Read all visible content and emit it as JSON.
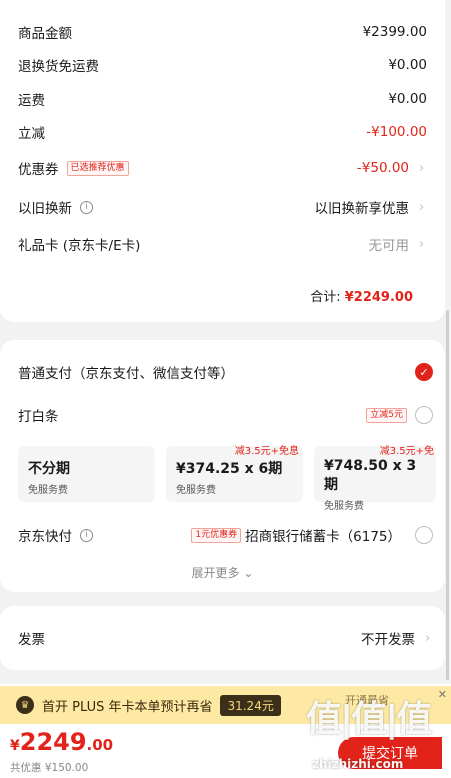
{
  "summary": {
    "goods_amount": {
      "label": "商品金额",
      "value": "¥2399.00"
    },
    "return_shipping": {
      "label": "退换货免运费",
      "value": "¥0.00"
    },
    "shipping": {
      "label": "运费",
      "value": "¥0.00"
    },
    "instant_discount": {
      "label": "立减",
      "value": "-¥100.00"
    },
    "coupon": {
      "label": "优惠券",
      "tag": "已选推荐优惠",
      "value": "-¥50.00"
    },
    "trade_in": {
      "label": "以旧换新",
      "value": "以旧换新享优惠"
    },
    "gift_card": {
      "label": "礼品卡 (京东卡/E卡)",
      "value": "无可用"
    },
    "total_label": "合计:",
    "total_value": "¥2249.00"
  },
  "payment": {
    "normal": {
      "label": "普通支付（京东支付、微信支付等）"
    },
    "baitiao": {
      "label": "打白条",
      "tag": "立减5元"
    },
    "plans": [
      {
        "title": "不分期",
        "sub": "免服务费",
        "promo": ""
      },
      {
        "title": "¥374.25 x 6期",
        "sub": "免服务费",
        "promo": "减3.5元+免息"
      },
      {
        "title": "¥748.50 x 3期",
        "sub": "免服务费",
        "promo": "减3.5元+免"
      }
    ],
    "jd_quickpay": {
      "label": "京东快付",
      "tag": "1元优惠券",
      "card": "招商银行储蓄卡（6175）"
    },
    "expand_more": "展开更多"
  },
  "invoice": {
    "label": "发票",
    "value": "不开发票"
  },
  "plus_banner": {
    "text": "首开 PLUS 年卡本单预计再省",
    "amount": "31.24元",
    "hint": "开通最省"
  },
  "footer": {
    "currency": "¥",
    "price_int": "2249",
    "price_dec": ".00",
    "saved": "共优惠 ¥150.00",
    "submit": "提交订单"
  },
  "watermark": {
    "logo": "值|值|值",
    "url": "zhizhizhi.com"
  },
  "colors": {
    "accent": "#e2231a",
    "plus_bg": "#fde9a3",
    "plus_dark": "#3b2f1a"
  }
}
